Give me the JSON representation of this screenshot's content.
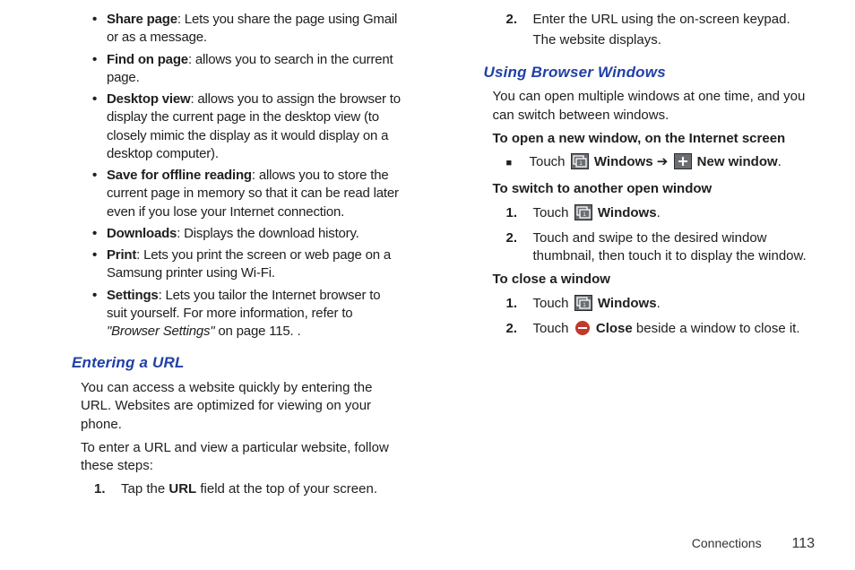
{
  "left": {
    "bullets": [
      {
        "term": "Share page",
        "desc": ": Lets you share the page using Gmail or as a message."
      },
      {
        "term": "Find on page",
        "desc": ": allows you to search in the current page."
      },
      {
        "term": "Desktop view",
        "desc": ": allows you to assign the browser to display the current page in the desktop view (to closely mimic the display as it would display on a desktop computer)."
      },
      {
        "term": "Save for offline reading",
        "desc": ": allows you to store the current page in memory so that it can be read later even if you lose your Internet connection."
      },
      {
        "term": "Downloads",
        "desc": ": Displays the download history."
      },
      {
        "term": "Print",
        "desc": ": Lets you print the screen or web page on a Samsung printer using Wi-Fi."
      },
      {
        "term": "Settings",
        "desc_a": ": Lets you tailor the Internet browser to suit yourself. For more information, refer to ",
        "desc_link": "\"Browser Settings\"",
        "desc_b": "  on page 115. ."
      }
    ],
    "entering_head": "Entering a URL",
    "entering_p1": "You can access a website quickly by entering the URL. Websites are optimized for viewing on your phone.",
    "entering_p2": "To enter a URL and view a particular website, follow these steps:",
    "step1_num": "1.",
    "step1_a": "Tap the ",
    "step1_bold": "URL",
    "step1_b": " field at the top of your screen."
  },
  "right": {
    "step2_num": "2.",
    "step2_a": "Enter the URL using the on-screen keypad.",
    "step2_b": "The website displays.",
    "using_head": "Using Browser Windows",
    "using_p1": "You can open multiple windows at one time, and you can switch between windows.",
    "open_head": "To open a new window, on the Internet screen",
    "open_touch": "Touch ",
    "open_windows": " Windows",
    "open_arrow": " ➔ ",
    "open_newwin": " New window",
    "open_period": ".",
    "switch_head": "To switch to another open window",
    "switch1_num": "1.",
    "switch1_touch": "Touch ",
    "switch1_windows": " Windows",
    "switch1_period": ".",
    "switch2_num": "2.",
    "switch2_text": "Touch and swipe to the desired window thumbnail, then touch it to display the window.",
    "close_head": "To close a window",
    "close1_num": "1.",
    "close1_touch": "Touch ",
    "close1_windows": " Windows",
    "close1_period": ".",
    "close2_num": "2.",
    "close2_touch": "Touch ",
    "close2_close": " Close",
    "close2_rest": " beside a window to close it."
  },
  "footer": {
    "chapter": "Connections",
    "page": "113"
  }
}
